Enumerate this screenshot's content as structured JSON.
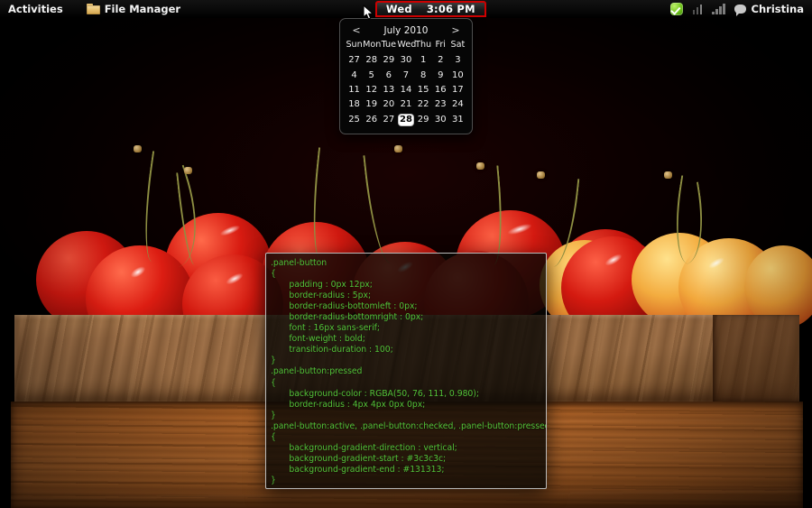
{
  "panel": {
    "activities_label": "Activities",
    "file_manager_label": "File Manager",
    "file_manager_icon": "folder-icon",
    "status_icons": [
      "check-circle-icon",
      "signal-bars-icon",
      "network-bars-icon"
    ],
    "user_name": "Christina",
    "user_icon": "chat-bubble-icon",
    "clock": {
      "day": "Wed",
      "time": "3:06 PM",
      "border_color": "#cc0000"
    }
  },
  "calendar": {
    "prev_label": "<",
    "next_label": ">",
    "title": "July 2010",
    "weekdays": [
      "Sun",
      "Mon",
      "Tue",
      "Wed",
      "Thu",
      "Fri",
      "Sat"
    ],
    "weeks": [
      [
        "27",
        "28",
        "29",
        "30",
        "1",
        "2",
        "3"
      ],
      [
        "4",
        "5",
        "6",
        "7",
        "8",
        "9",
        "10"
      ],
      [
        "11",
        "12",
        "13",
        "14",
        "15",
        "16",
        "17"
      ],
      [
        "18",
        "19",
        "20",
        "21",
        "22",
        "23",
        "24"
      ],
      [
        "25",
        "26",
        "27",
        "28",
        "29",
        "30",
        "31"
      ]
    ],
    "today": "28",
    "today_row": 4,
    "today_col": 3,
    "today_bg": "#ffffff",
    "today_fg": "#000000"
  },
  "code_panel": {
    "text_color": "#56c43a",
    "content": ".panel-button\n{\n       padding : 0px 12px;\n       border-radius : 5px;\n       border-radius-bottomleft : 0px;\n       border-radius-bottomright : 0px;\n       font : 16px sans-serif;\n       font-weight : bold;\n       transition-duration : 100;\n}\n.panel-button:pressed\n{\n       background-color : RGBA(50, 76, 111, 0.980);\n       border-radius : 4px 4px 0px 0px;\n}\n.panel-button:active, .panel-button:checked, .panel-button:pressed\n{\n       background-gradient-direction : vertical;\n       background-gradient-start : #3c3c3c;\n       background-gradient-end : #131313;\n}"
  },
  "wallpaper": {
    "description": "cherries-on-wood-photo",
    "dark_bg": "#000000",
    "cherry_red": "#d01a12",
    "cherry_yellow": "#e9a83a",
    "wood_top": "#a0724a",
    "wood_bottom": "#b3682c"
  }
}
